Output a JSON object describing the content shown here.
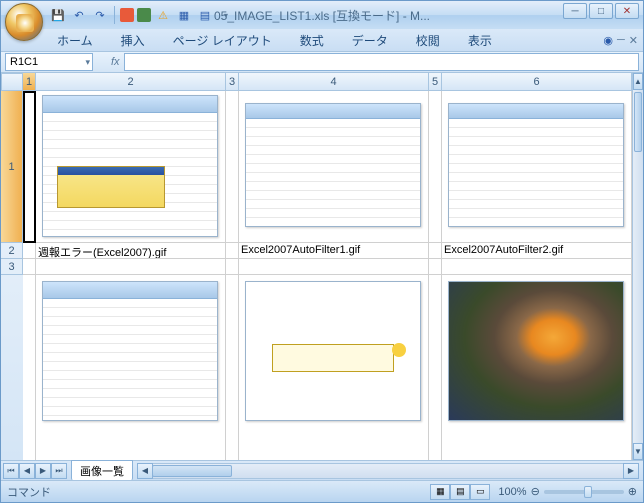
{
  "window": {
    "title": "05_IMAGE_LIST1.xls [互換モード] - M..."
  },
  "ribbon": {
    "tabs": [
      "ホーム",
      "挿入",
      "ページ レイアウト",
      "数式",
      "データ",
      "校閲",
      "表示"
    ]
  },
  "namebox": {
    "value": "R1C1",
    "fx": "fx"
  },
  "columns": {
    "c1": "1",
    "c2": "2",
    "c3": "3",
    "c4": "4",
    "c5": "5",
    "c6": "6"
  },
  "rows": {
    "r1": "1",
    "r2": "2",
    "r3": "3"
  },
  "cells": {
    "r2c2": "週報エラー(Excel2007).gif",
    "r2c4": "Excel2007AutoFilter1.gif",
    "r2c6": "Excel2007AutoFilter2.gif"
  },
  "sheet": {
    "active": "画像一覧"
  },
  "status": {
    "mode": "コマンド",
    "zoom": "100%"
  }
}
